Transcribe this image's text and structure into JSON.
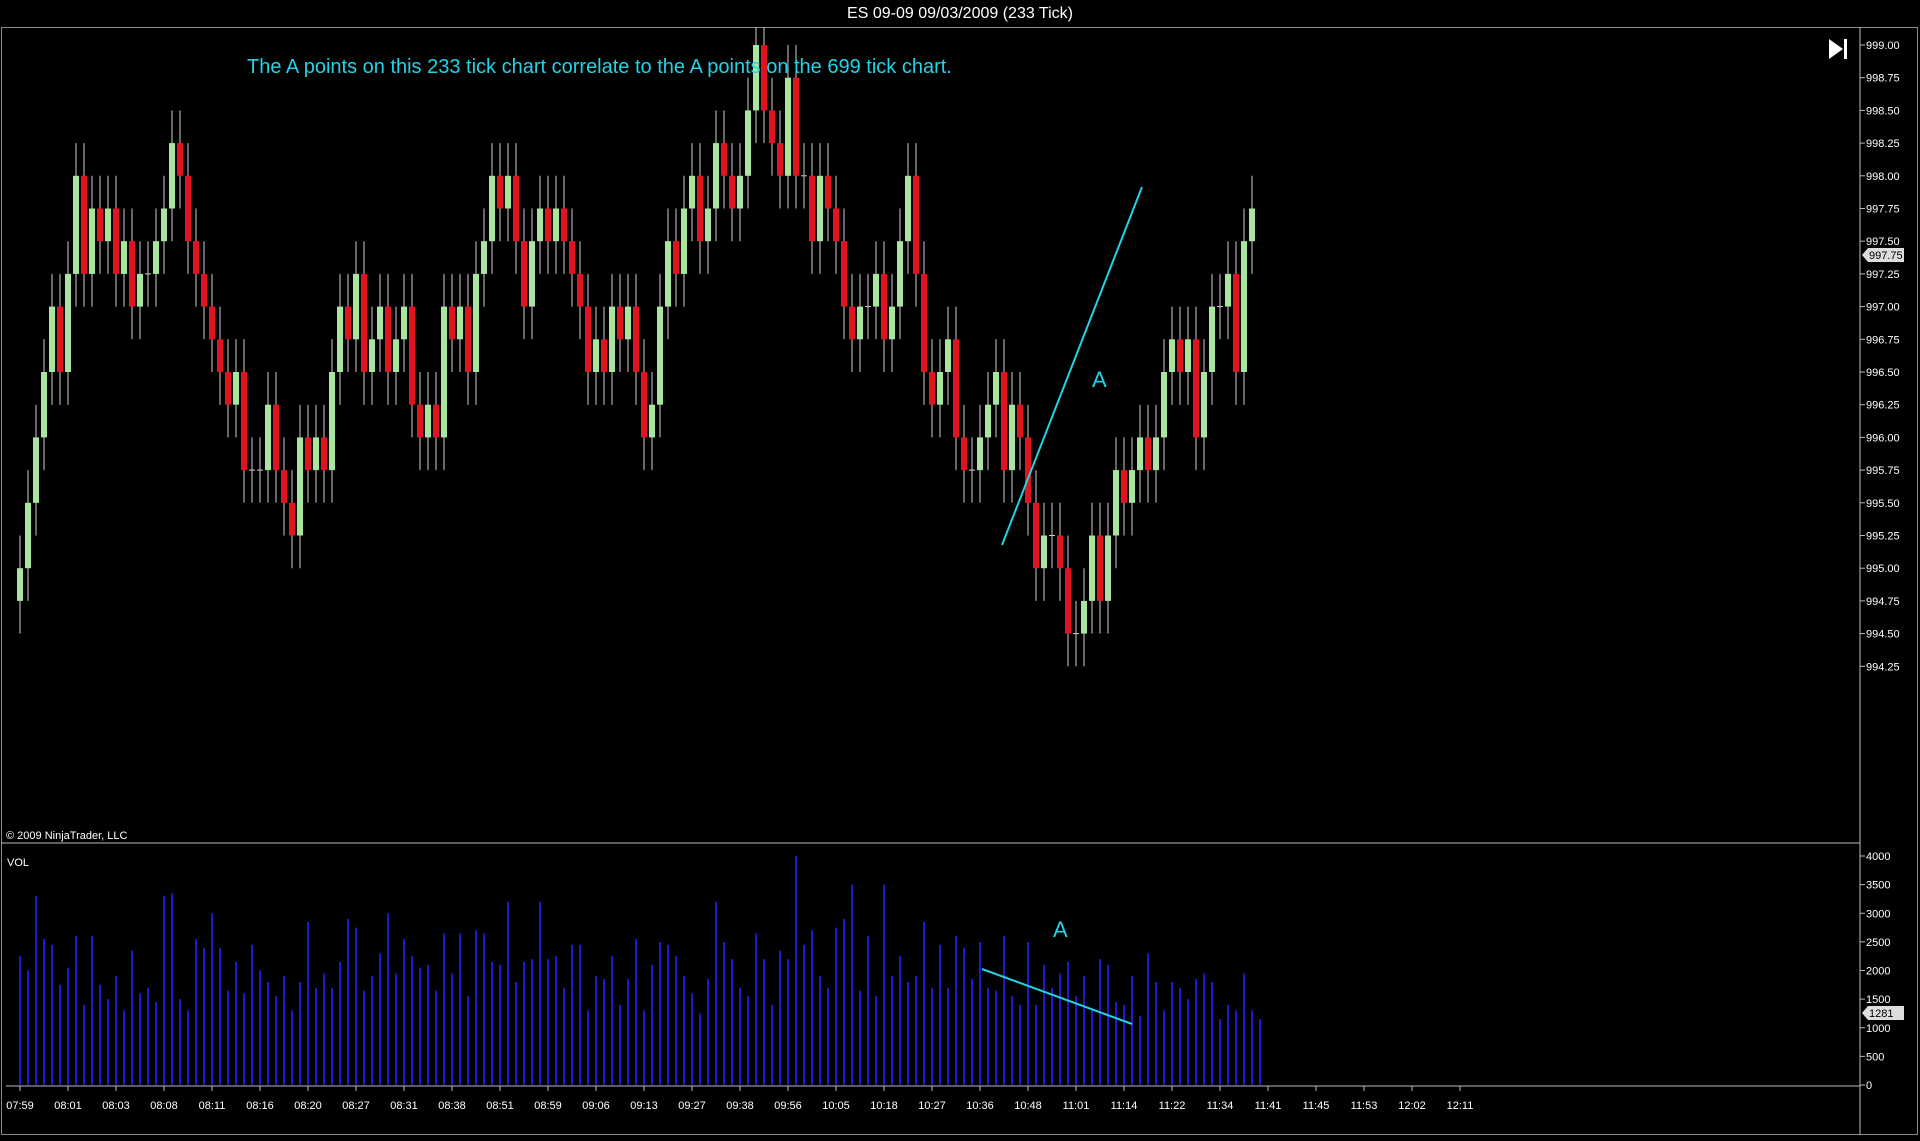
{
  "window": {
    "title": "ES 09-09  09/03/2009 (233 Tick)"
  },
  "price_panel": {
    "annotation": "The A points on this 233 tick chart correlate to the A points on the 699 tick chart.",
    "trend_label": "A",
    "copyright": "© 2009 NinjaTrader, LLC",
    "last_price_tag": "997.75",
    "scroll_end_icon": "skip-to-end-icon"
  },
  "volume_panel": {
    "label": "VOL",
    "trend_label": "A",
    "last_volume_tag": "1281"
  },
  "colors": {
    "up_candle": "#a8e6a0",
    "down_candle": "#e0141e",
    "wick": "#cccccc",
    "volume_bar": "#1a1ad0",
    "annotation": "#22d3e6",
    "axis_text": "#ffffff",
    "axis_line": "#bbbbbb"
  },
  "chart_data": [
    {
      "type": "candlestick",
      "title": "ES 09-09  09/03/2009 (233 Tick)",
      "ylim": [
        994.12,
        999.1
      ],
      "y_ticks": [
        "999.00",
        "998.75",
        "998.50",
        "998.25",
        "998.00",
        "997.75",
        "997.50",
        "997.25",
        "997.00",
        "996.75",
        "996.50",
        "996.25",
        "996.00",
        "995.75",
        "995.50",
        "995.25",
        "995.00",
        "994.75",
        "994.50",
        "994.25"
      ],
      "x_ticks": [
        "07:59",
        "08:01",
        "08:03",
        "08:08",
        "08:11",
        "08:16",
        "08:20",
        "08:27",
        "08:31",
        "08:38",
        "08:51",
        "08:59",
        "09:06",
        "09:13",
        "09:27",
        "09:38",
        "09:56",
        "10:05",
        "10:18",
        "10:27",
        "10:36",
        "10:48",
        "11:01",
        "11:14",
        "11:22",
        "11:34",
        "11:41",
        "11:45",
        "11:53",
        "12:02",
        "12:11"
      ],
      "x_tick_bar_index": [
        0,
        6,
        12,
        18,
        24,
        30,
        36,
        42,
        48,
        54,
        60,
        66,
        72,
        78,
        84,
        90,
        96,
        102,
        108,
        114,
        120,
        126,
        132,
        138,
        144,
        150,
        156,
        162,
        168,
        174,
        180
      ],
      "closes": [
        995,
        995.5,
        996,
        996.5,
        997,
        996.5,
        997.25,
        998,
        997.25,
        997.75,
        997.5,
        997.75,
        997.25,
        997.5,
        997,
        997.25,
        997.25,
        997.5,
        997.75,
        998.25,
        998,
        997.5,
        997.25,
        997,
        996.75,
        996.5,
        996.25,
        996.5,
        995.75,
        995.75,
        995.75,
        996.25,
        995.75,
        995.5,
        995.25,
        996,
        995.75,
        996,
        995.75,
        996.5,
        997,
        996.75,
        997.25,
        996.5,
        996.75,
        997,
        996.5,
        996.75,
        997,
        996.25,
        996,
        996.25,
        996,
        997,
        996.75,
        997,
        996.5,
        997.25,
        997.5,
        998,
        997.75,
        998,
        997.5,
        997,
        997.5,
        997.75,
        997.5,
        997.75,
        997.5,
        997.25,
        997,
        996.5,
        996.75,
        996.5,
        997,
        996.75,
        997,
        996.5,
        996,
        996.25,
        997,
        997.5,
        997.25,
        997.75,
        998,
        997.5,
        997.75,
        998.25,
        998,
        997.75,
        998,
        998.5,
        999,
        998.5,
        998.25,
        998,
        998.75,
        998,
        998,
        997.5,
        998,
        997.75,
        997.5,
        997,
        996.75,
        997,
        997,
        997.25,
        996.75,
        997,
        997.5,
        998,
        997.25,
        996.5,
        996.25,
        996.5,
        996.75,
        996,
        995.75,
        995.75,
        996,
        996.25,
        996.5,
        995.75,
        996.25,
        996,
        995.5,
        995,
        995.25,
        995.25,
        995,
        994.5,
        994.5,
        994.75,
        995.25,
        994.75,
        995.25,
        995.75,
        995.5,
        995.75,
        996,
        995.75,
        996,
        996.5,
        996.75,
        996.5,
        996.75,
        996,
        996.5,
        997,
        997,
        997.25,
        996.5,
        997.5,
        997.75
      ],
      "volumes": [
        2250,
        2000,
        3300,
        2550,
        2450,
        1750,
        2050,
        2600,
        1400,
        2600,
        1750,
        1500,
        1900,
        1300,
        2350,
        1600,
        1700,
        1450,
        3300,
        3350,
        1500,
        1300,
        2550,
        2400,
        3000,
        2400,
        1650,
        2150,
        1600,
        2450,
        2000,
        1800,
        1550,
        1900,
        1300,
        1800,
        2850,
        1700,
        1950,
        1700,
        2150,
        2900,
        2750,
        1650,
        1900,
        2300,
        3000,
        1950,
        2550,
        2250,
        2050,
        2100,
        1650,
        2650,
        1950,
        2650,
        1550,
        2700,
        2650,
        2150,
        2100,
        3200,
        1800,
        2150,
        2200,
        3200,
        2200,
        2250,
        1700,
        2450,
        2450,
        1300,
        1900,
        1850,
        2250,
        1400,
        1850,
        2550,
        1300,
        2100,
        2500,
        2450,
        2250,
        1900,
        1600,
        1250,
        1850,
        3200,
        2500,
        2200,
        1700,
        1550,
        2650,
        2200,
        1400,
        2350,
        2200,
        4000,
        2450,
        2700,
        1900,
        1700,
        2750,
        2900,
        3500,
        1650,
        2600,
        1550,
        3500,
        1900,
        2250,
        1800,
        1900,
        2850,
        1700,
        2450,
        1700,
        2600,
        2400,
        1850,
        2500,
        1700,
        1650,
        2600,
        1550,
        1400,
        2500,
        1400,
        2100,
        1700,
        1950,
        2150,
        1550,
        1900,
        1350,
        2200,
        2100,
        1450,
        1400,
        1900,
        1200,
        2300,
        1800,
        1300,
        1800,
        1700,
        1500,
        1850,
        1950,
        1800,
        1150,
        1400,
        1300,
        1950,
        1300,
        1150
      ],
      "ylim_volume": [
        0,
        4000
      ],
      "y_ticks_volume": [
        "4000",
        "3500",
        "3000",
        "2500",
        "2000",
        "1500",
        "1000",
        "500",
        "0"
      ]
    }
  ]
}
